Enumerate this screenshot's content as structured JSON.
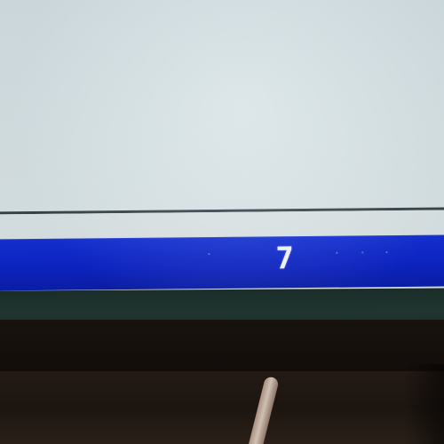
{
  "status_bar": {
    "page_number": "7"
  },
  "colors": {
    "screen_background": "#d7e3e6",
    "status_bar": "#0d24c6",
    "text": "#f2f6ff",
    "bezel": "#203531"
  }
}
